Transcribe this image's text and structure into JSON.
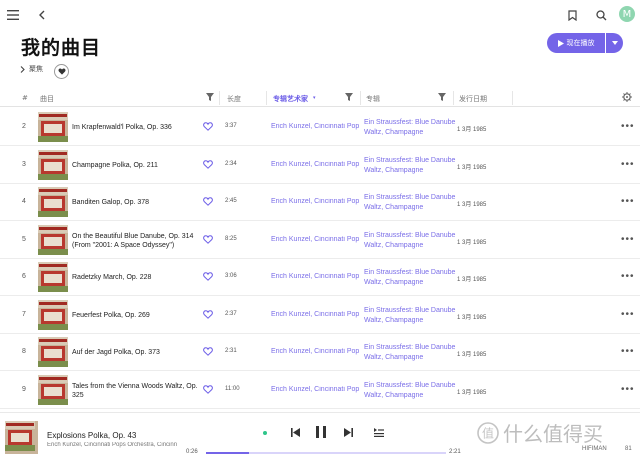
{
  "header": {
    "avatar_letter": "M"
  },
  "page": {
    "title": "我的曲目",
    "play_now_label": "现在播放",
    "focus_label": "聚焦"
  },
  "columns": {
    "index": "#",
    "track": "曲目",
    "duration": "长度",
    "artist": "专辑艺术家",
    "album": "专辑",
    "release_date": "发行日期"
  },
  "rows": [
    {
      "index": "2",
      "title": "Im Krapfenwald'l Polka, Op. 336",
      "duration": "3:37",
      "artist": "Erich Kunzel, Cincinnati Pops",
      "album": "Ein Straussfest: Blue Danube Waltz, Champagne",
      "date": "1 3月 1985"
    },
    {
      "index": "3",
      "title": "Champagne Polka, Op. 211",
      "duration": "2:34",
      "artist": "Erich Kunzel, Cincinnati Pops",
      "album": "Ein Straussfest: Blue Danube Waltz, Champagne",
      "date": "1 3月 1985"
    },
    {
      "index": "4",
      "title": "Banditen Galop, Op. 378",
      "duration": "2:45",
      "artist": "Erich Kunzel, Cincinnati Pops",
      "album": "Ein Straussfest: Blue Danube Waltz, Champagne",
      "date": "1 3月 1985"
    },
    {
      "index": "5",
      "title": "On the Beautiful Blue Danube, Op. 314 (From \"2001: A Space Odyssey\")",
      "duration": "8:25",
      "artist": "Erich Kunzel, Cincinnati Pops",
      "album": "Ein Straussfest: Blue Danube Waltz, Champagne",
      "date": "1 3月 1985"
    },
    {
      "index": "6",
      "title": "Radetzky March, Op. 228",
      "duration": "3:06",
      "artist": "Erich Kunzel, Cincinnati Pops",
      "album": "Ein Straussfest: Blue Danube Waltz, Champagne",
      "date": "1 3月 1985"
    },
    {
      "index": "7",
      "title": "Feuerfest Polka, Op. 269",
      "duration": "2:37",
      "artist": "Erich Kunzel, Cincinnati Pops",
      "album": "Ein Straussfest: Blue Danube Waltz, Champagne",
      "date": "1 3月 1985"
    },
    {
      "index": "8",
      "title": "Auf der Jagd Polka, Op. 373",
      "duration": "2:31",
      "artist": "Erich Kunzel, Cincinnati Pops",
      "album": "Ein Straussfest: Blue Danube Waltz, Champagne",
      "date": "1 3月 1985"
    },
    {
      "index": "9",
      "title": "Tales from the Vienna Woods Waltz, Op. 325",
      "duration": "11:00",
      "artist": "Erich Kunzel, Cincinnati Pops",
      "album": "Ein Straussfest: Blue Danube Waltz, Champagne",
      "date": "1 3月 1985"
    }
  ],
  "player": {
    "title": "Explosions Polka, Op. 43",
    "artist": "Erich Kunzel, Cincinnati Pops Orchestra, Cincinnati P",
    "elapsed": "0:26",
    "total": "2:21",
    "progress_fraction": 0.18,
    "device": "HIFIMAN",
    "volume": "81"
  },
  "watermark": {
    "text": "什么值得买",
    "logo_char": "值"
  },
  "colors": {
    "accent": "#7464e8",
    "link": "#7a6ee8",
    "avatar": "#8fd6b0",
    "playing_dot": "#2ec58a"
  },
  "icons": [
    "menu-icon",
    "back-icon",
    "bookmark-icon",
    "search-icon",
    "play-icon",
    "caret-down-icon",
    "chevron-right-icon",
    "heart-icon",
    "filter-icon",
    "sort-caret-icon",
    "settings-icon",
    "more-icon",
    "previous-icon",
    "pause-icon",
    "next-icon",
    "queue-icon"
  ]
}
